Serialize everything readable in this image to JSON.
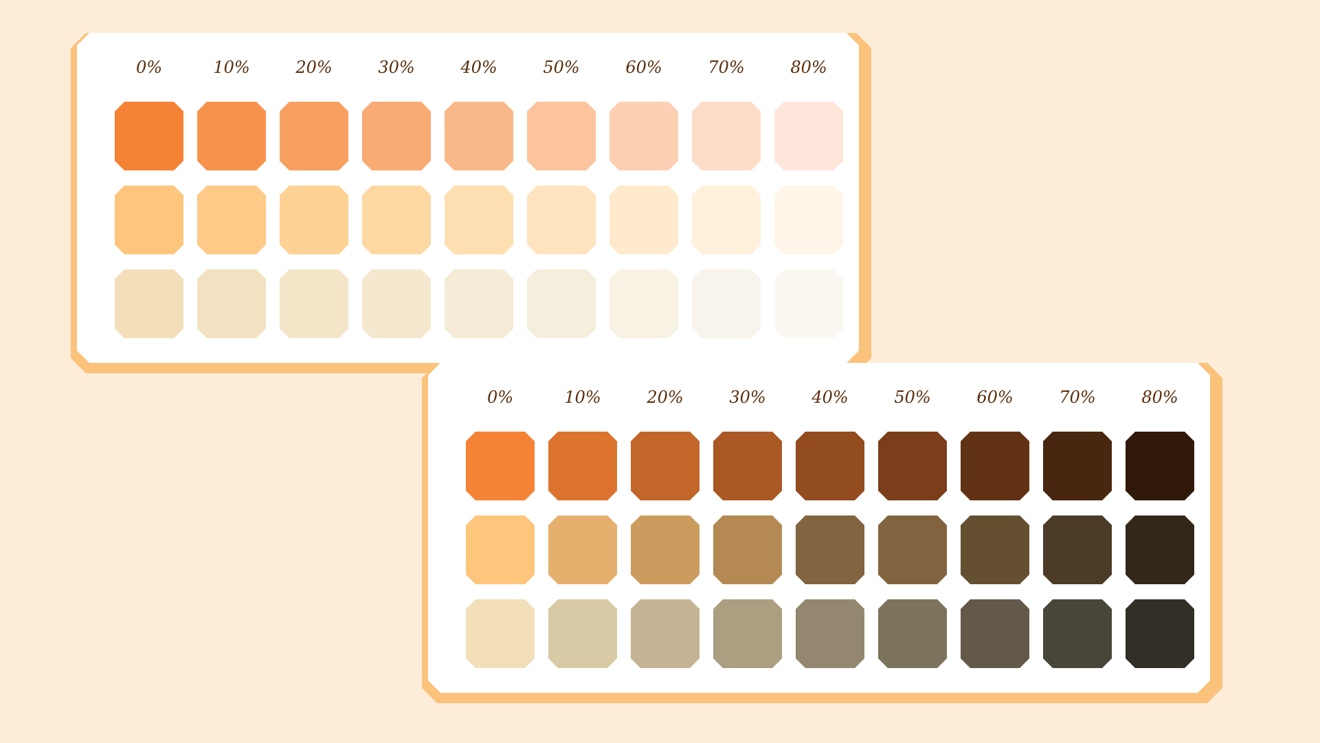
{
  "palettes": [
    {
      "id": "tints",
      "labels": [
        "0%",
        "10%",
        "20%",
        "30%",
        "40%",
        "50%",
        "60%",
        "70%",
        "80%"
      ],
      "rows": [
        [
          "#f58335",
          "#f6924b",
          "#f7a060",
          "#f8ac74",
          "#f9b889",
          "#fbc49d",
          "#fcd0b3",
          "#fddcc7",
          "#fee7da"
        ],
        [
          "#fec67c",
          "#feca87",
          "#fed294",
          "#fed8a2",
          "#fedfb1",
          "#fee4bf",
          "#ffeacd",
          "#fff0dc",
          "#fff5e8"
        ],
        [
          "#f2dfba",
          "#f2e2c1",
          "#f4e5c8",
          "#f4e8cf",
          "#f6ebd6",
          "#f6eedd",
          "#f8f2e4",
          "#f9f4eb",
          "#fbf8f1"
        ]
      ]
    },
    {
      "id": "shades",
      "labels": [
        "0%",
        "10%",
        "20%",
        "30%",
        "40%",
        "50%",
        "60%",
        "70%",
        "80%"
      ],
      "rows": [
        [
          "#f58335",
          "#dc7430",
          "#c3662a",
          "#aa5925",
          "#924c1f",
          "#7a3f1a",
          "#623215",
          "#49260f",
          "#31190a"
        ],
        [
          "#fec67c",
          "#e5b06e",
          "#cb9c5e",
          "#b48953",
          "#826441",
          "#81643f",
          "#654f31",
          "#4c3b26",
          "#322819"
        ],
        [
          "#f2dfba",
          "#d9caa6",
          "#c4b493",
          "#ab9e81",
          "#93886f",
          "#7b735c",
          "#62594a",
          "#484638",
          "#312f26"
        ]
      ]
    }
  ]
}
